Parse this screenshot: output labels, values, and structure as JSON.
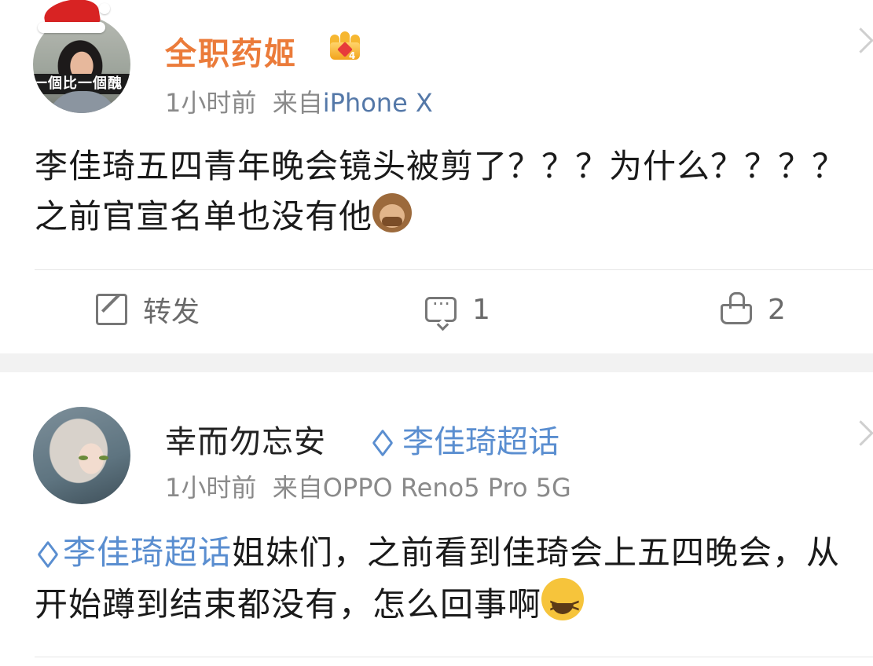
{
  "post1": {
    "username": "全职药姬",
    "time": "1小时前",
    "from_label": "来自",
    "source": "iPhone X",
    "text": "李佳琦五四青年晚会镜头被剪了？？？为什么？？？？之前官宣名单也没有他",
    "avatar_banner": "一個比一個醜",
    "actions": {
      "repost": "转发",
      "comments": "1",
      "likes": "2"
    },
    "badge_icon": "crown-level-icon",
    "trailing_emoji": "see-no-evil-monkey"
  },
  "post2": {
    "username": "幸而勿忘安",
    "topic_tag": "李佳琦超话",
    "time": "1小时前",
    "from_label": "来自",
    "source": "OPPO Reno5 Pro 5G",
    "inline_topic": "李佳琦超话",
    "text": "姐妹们，之前看到佳琦会上五四晚会，从开始蹲到结束都没有，怎么回事啊",
    "trailing_emoji": "tired-face"
  },
  "colors": {
    "username_vip": "#eb7b3a",
    "topic_blue": "#5a8ed0",
    "source_blue": "#5478a8",
    "meta_gray": "#8a8a8a"
  }
}
